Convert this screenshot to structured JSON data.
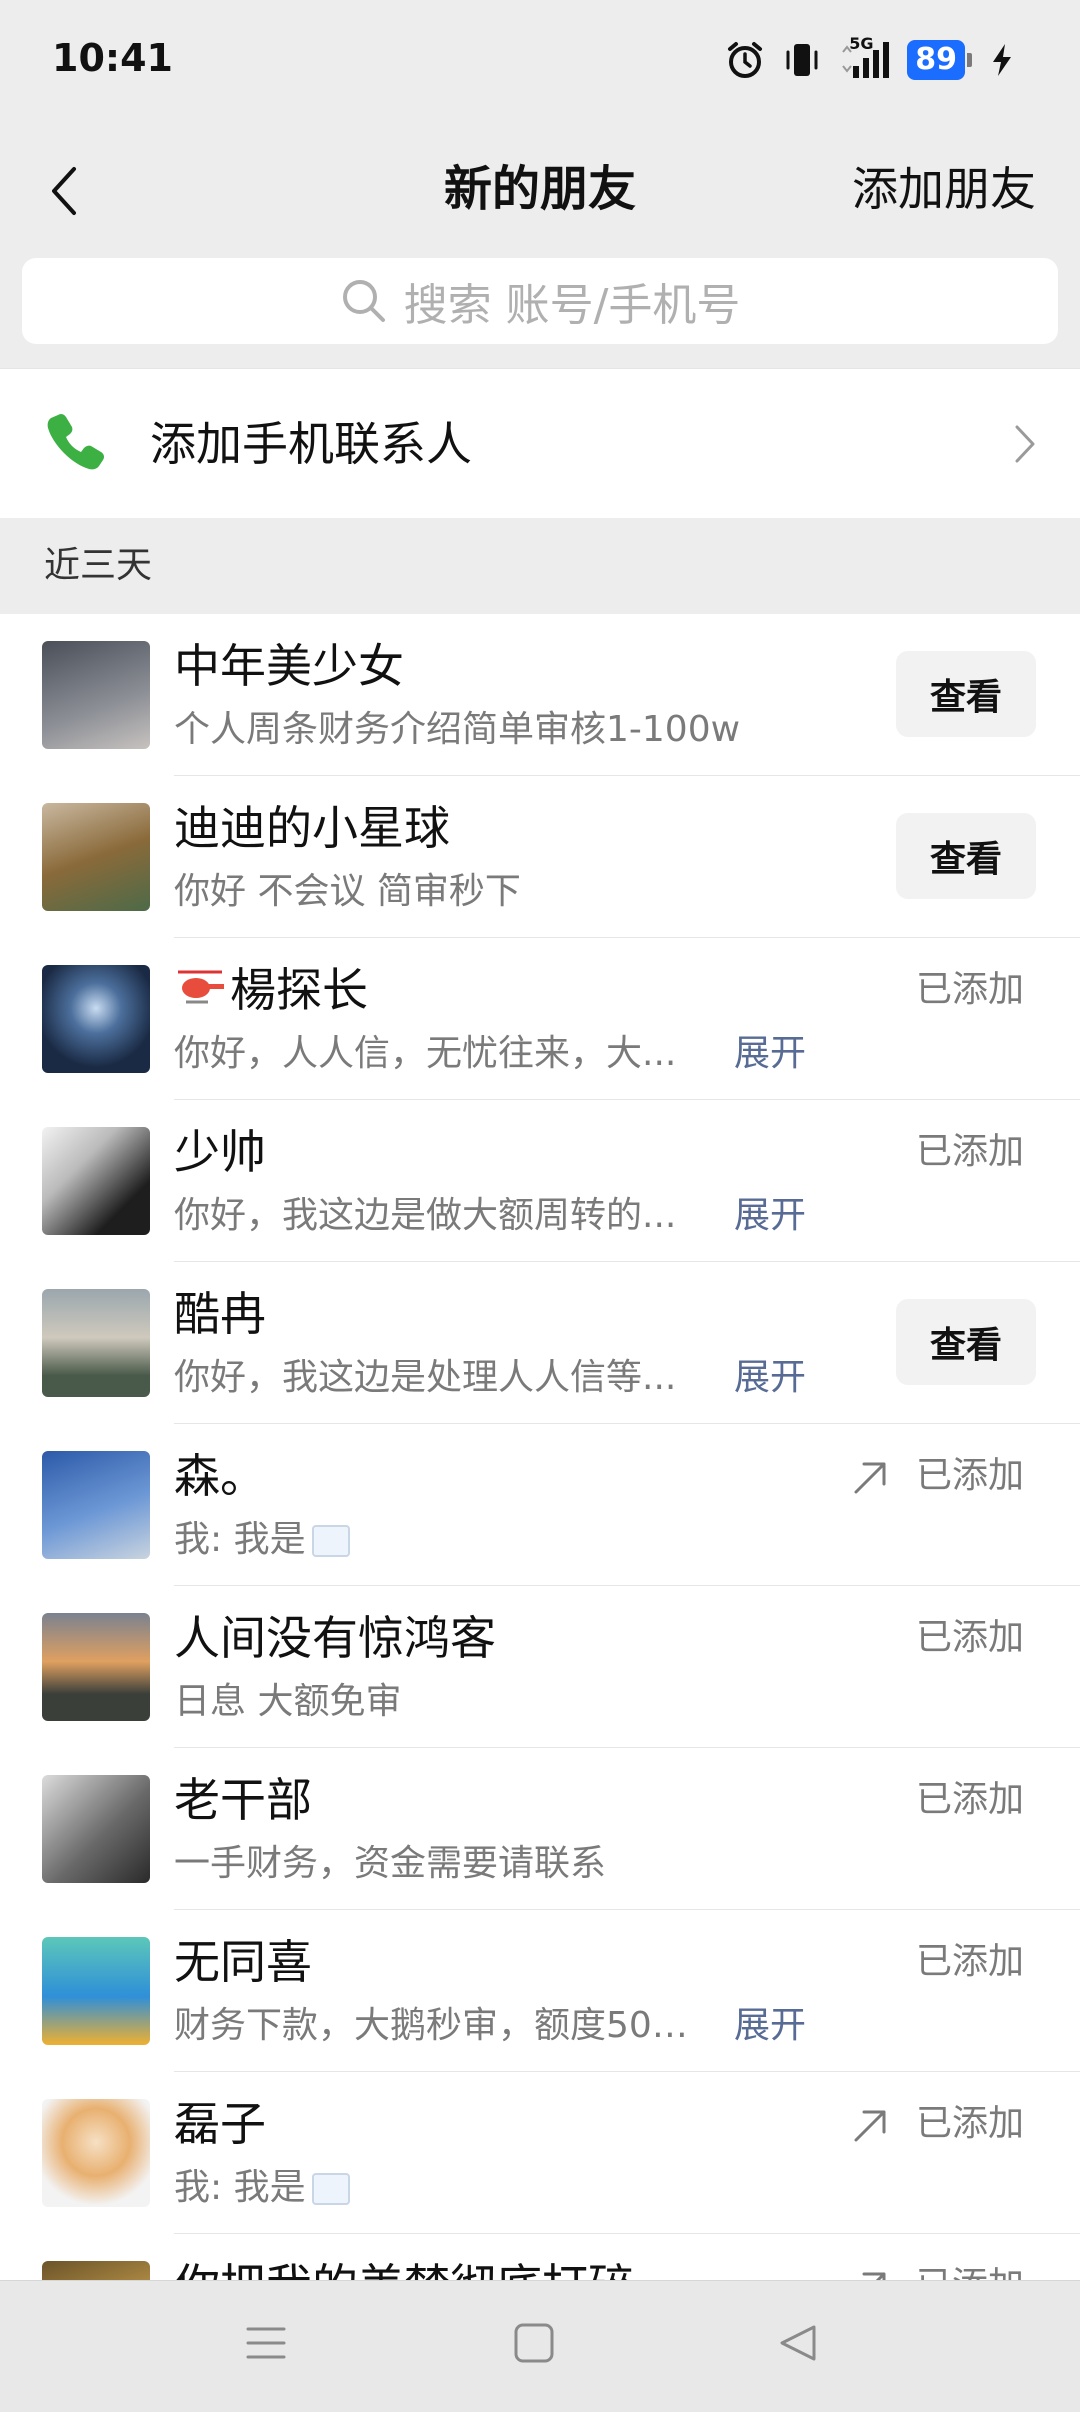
{
  "status_bar": {
    "time": "10:41",
    "network": "5G",
    "battery": "89"
  },
  "header": {
    "title": "新的朋友",
    "add_friends": "添加朋友"
  },
  "search": {
    "placeholder": "搜索 账号/手机号"
  },
  "phone_contacts": {
    "label": "添加手机联系人"
  },
  "section": {
    "label": "近三天"
  },
  "friends": [
    {
      "name": "中年美少女",
      "message": "个人周条财务介绍简单审核1-100w",
      "status": "查看",
      "avatar_color": "#6a6f78"
    },
    {
      "name": "迪迪的小星球",
      "message": "你好  不会议  简审秒下",
      "status": "查看",
      "avatar_color": "#8a6a3a"
    },
    {
      "name": "楊探长",
      "message": "你好，人人信，无忧往来，大...",
      "expand": "展开",
      "status": "已添加",
      "avatar_color": "#1f3a5c"
    },
    {
      "name": "少帅",
      "message": "你好，我这边是做大额周转的...",
      "expand": "展开",
      "status": "已添加",
      "avatar_color": "#2a2a2a"
    },
    {
      "name": "酷冉",
      "message": "你好，我这边是处理人人信等...",
      "expand": "展开",
      "status": "查看",
      "avatar_color": "#6f7c82"
    },
    {
      "name": "森。",
      "message": "我: 我是",
      "status": "已添加",
      "avatar_color": "#3f6fb5"
    },
    {
      "name": "人间没有惊鸿客",
      "message": "日息  大额免审",
      "status": "已添加",
      "avatar_color": "#5b4a3e"
    },
    {
      "name": "老干部",
      "message": "一手财务，资金需要请联系",
      "status": "已添加",
      "avatar_color": "#555555"
    },
    {
      "name": "无同喜",
      "message": "财务下款，大鹅秒审，额度500...",
      "expand": "展开",
      "status": "已添加",
      "avatar_color": "#3fb2a6"
    },
    {
      "name": "磊子",
      "message": "我: 我是",
      "status": "已添加",
      "avatar_color": "#e8c38f"
    },
    {
      "name": "你把我的美梦彻底打碎",
      "message": "",
      "status": "已添加",
      "avatar_color": "#8a6a2a"
    }
  ]
}
